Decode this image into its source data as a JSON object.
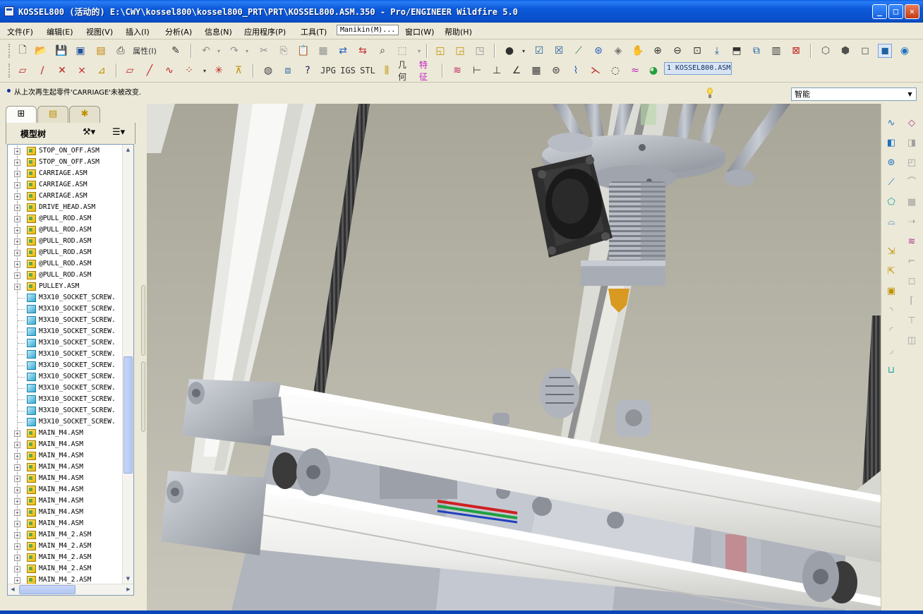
{
  "window": {
    "title": "KOSSEL800 (活动的) E:\\CWY\\kossel800\\kossel800_PRT\\PRT\\KOSSEL800.ASM.350 - Pro/ENGINEER Wildfire 5.0",
    "minimize": "_",
    "maximize": "□",
    "close": "✕"
  },
  "menu": {
    "file": "文件(F)",
    "edit": "编辑(E)",
    "view": "视图(V)",
    "insert": "插入(I)",
    "analysis": "分析(A)",
    "info": "信息(N)",
    "applications": "应用程序(P)",
    "tools": "工具(T)",
    "manikin": "Manikin(M)...",
    "window": "窗口(W)",
    "help": "帮助(H)"
  },
  "toolbar": {
    "properties_label": "属性(I)",
    "jpg_label": "JPG",
    "igs_label": "IGS",
    "stl_label": "STL",
    "geometry_label": "几何",
    "feature_label": "特征",
    "active_model": "1 KOSSEL800.ASM"
  },
  "message": {
    "text": "从上次再生起零件'CARRIAGE'未被改变."
  },
  "filter": {
    "value": "智能"
  },
  "model_tree": {
    "title": "模型树",
    "tab_icons": [
      "tree-icon",
      "folder-icon",
      "favorites-icon"
    ],
    "items": [
      {
        "label": "STOP_ON_OFF.ASM",
        "type": "asm"
      },
      {
        "label": "STOP_ON_OFF.ASM",
        "type": "asm"
      },
      {
        "label": "CARRIAGE.ASM",
        "type": "asm"
      },
      {
        "label": "CARRIAGE.ASM",
        "type": "asm"
      },
      {
        "label": "CARRIAGE.ASM",
        "type": "asm"
      },
      {
        "label": "DRIVE_HEAD.ASM",
        "type": "asm"
      },
      {
        "label": "@PULL_ROD.ASM",
        "type": "asm"
      },
      {
        "label": "@PULL_ROD.ASM",
        "type": "asm"
      },
      {
        "label": "@PULL_ROD.ASM",
        "type": "asm"
      },
      {
        "label": "@PULL_ROD.ASM",
        "type": "asm"
      },
      {
        "label": "@PULL_ROD.ASM",
        "type": "asm"
      },
      {
        "label": "@PULL_ROD.ASM",
        "type": "asm"
      },
      {
        "label": "PULLEY.ASM",
        "type": "asm"
      },
      {
        "label": "M3X10_SOCKET_SCREW.",
        "type": "prt"
      },
      {
        "label": "M3X10_SOCKET_SCREW.",
        "type": "prt"
      },
      {
        "label": "M3X10_SOCKET_SCREW.",
        "type": "prt"
      },
      {
        "label": "M3X10_SOCKET_SCREW.",
        "type": "prt"
      },
      {
        "label": "M3X10_SOCKET_SCREW.",
        "type": "prt"
      },
      {
        "label": "M3X10_SOCKET_SCREW.",
        "type": "prt"
      },
      {
        "label": "M3X10_SOCKET_SCREW.",
        "type": "prt"
      },
      {
        "label": "M3X10_SOCKET_SCREW.",
        "type": "prt"
      },
      {
        "label": "M3X10_SOCKET_SCREW.",
        "type": "prt"
      },
      {
        "label": "M3X10_SOCKET_SCREW.",
        "type": "prt"
      },
      {
        "label": "M3X10_SOCKET_SCREW.",
        "type": "prt"
      },
      {
        "label": "M3X10_SOCKET_SCREW.",
        "type": "prt"
      },
      {
        "label": "MAIN_M4.ASM",
        "type": "asm"
      },
      {
        "label": "MAIN_M4.ASM",
        "type": "asm"
      },
      {
        "label": "MAIN_M4.ASM",
        "type": "asm"
      },
      {
        "label": "MAIN_M4.ASM",
        "type": "asm"
      },
      {
        "label": "MAIN_M4.ASM",
        "type": "asm"
      },
      {
        "label": "MAIN_M4.ASM",
        "type": "asm"
      },
      {
        "label": "MAIN_M4.ASM",
        "type": "asm"
      },
      {
        "label": "MAIN_M4.ASM",
        "type": "asm"
      },
      {
        "label": "MAIN_M4.ASM",
        "type": "asm"
      },
      {
        "label": "MAIN_M4_2.ASM",
        "type": "asm"
      },
      {
        "label": "MAIN_M4_2.ASM",
        "type": "asm"
      },
      {
        "label": "MAIN_M4_2.ASM",
        "type": "asm"
      },
      {
        "label": "MAIN_M4_2.ASM",
        "type": "asm"
      },
      {
        "label": "MAIN_M4_2.ASM",
        "type": "asm"
      }
    ]
  },
  "colors": {
    "titlebar": "#0a58d8",
    "viewport_bg": "#b8b6a8",
    "extrusion": "#f2f2f0",
    "part_grey": "#a8acb4",
    "belt": "#2a2a2a",
    "nozzle": "#d89a20"
  }
}
